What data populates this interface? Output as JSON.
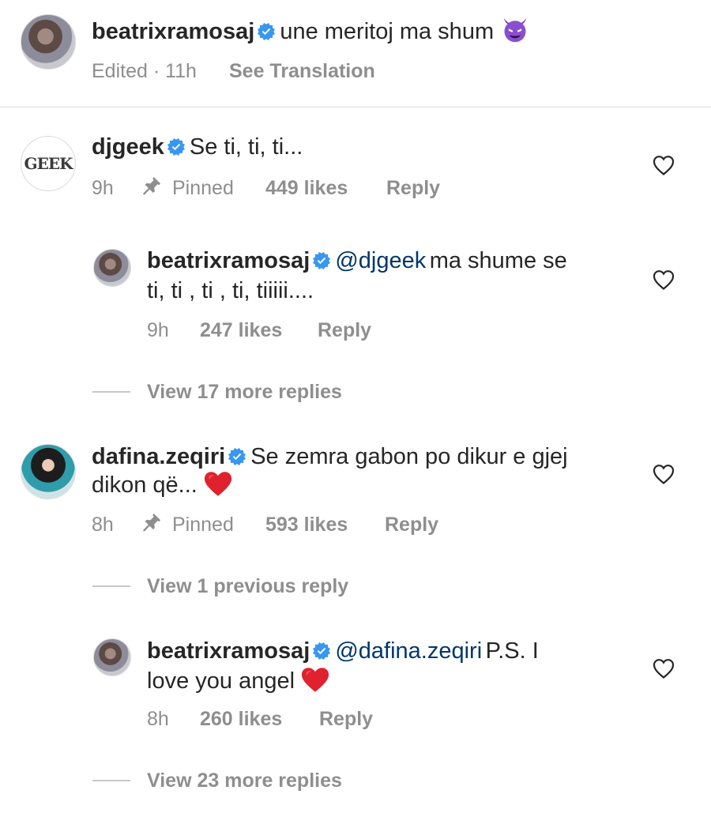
{
  "caption": {
    "username": "beatrixramosaj",
    "text": "une meritoj ma shum",
    "emoji": "😈",
    "edited": "Edited · 11h",
    "see_translation": "See Translation"
  },
  "comments": [
    {
      "username": "djgeek",
      "avatar_text": "GEEK",
      "text": "Se ti, ti, ti...",
      "time": "9h",
      "pinned": "Pinned",
      "likes": "449 likes",
      "reply": "Reply",
      "replies": [
        {
          "username": "beatrixramosaj",
          "mention": "@djgeek",
          "line1": "ma shume se",
          "line2": "ti, ti , ti , ti, tiiiii....",
          "time": "9h",
          "likes": "247 likes",
          "reply": "Reply"
        }
      ],
      "view_more": "View 17 more replies"
    },
    {
      "username": "dafina.zeqiri",
      "line1": "Se zemra gabon po dikur e gjej",
      "line2": "dikon që...",
      "emoji": "❤️",
      "time": "8h",
      "pinned": "Pinned",
      "likes": "593 likes",
      "reply": "Reply",
      "view_previous": "View 1 previous reply",
      "replies": [
        {
          "username": "beatrixramosaj",
          "mention": "@dafina.zeqiri",
          "line1": "P.S. I",
          "line2": "love you angel",
          "emoji": "❤️",
          "time": "8h",
          "likes": "260 likes",
          "reply": "Reply"
        }
      ],
      "view_more": "View 23 more replies"
    }
  ],
  "colors": {
    "text": "#262626",
    "secondary": "#8e8e8e",
    "verified": "#3897f0",
    "mention": "#00376b",
    "heart_emoji": "#e0222f",
    "devil_emoji": "#7b3fbe"
  },
  "icons": [
    "verified-badge-icon",
    "pin-icon",
    "heart-outline-icon",
    "devil-emoji-icon",
    "red-heart-emoji-icon"
  ]
}
